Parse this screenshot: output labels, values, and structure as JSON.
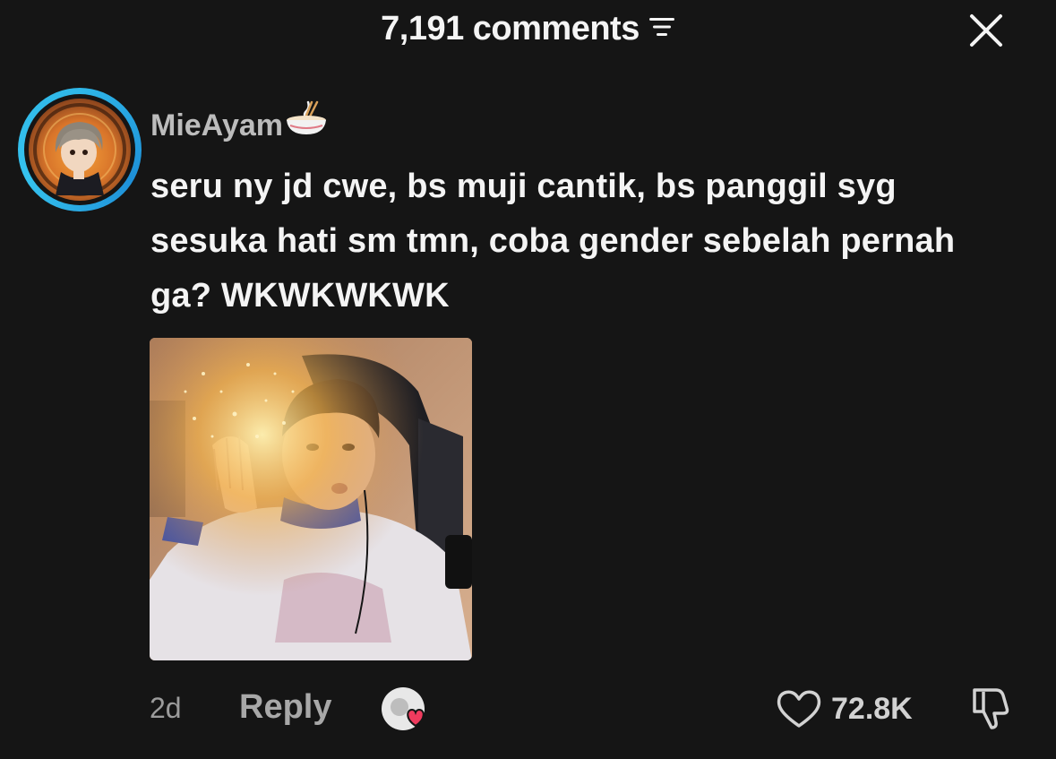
{
  "header": {
    "title": "7,191 comments",
    "sort_icon": "sort-lines-icon",
    "close_icon": "close-icon"
  },
  "comment": {
    "username": "MieAyam",
    "username_emoji": "noodle-bowl-icon",
    "text": "seru ny jd cwe, bs muji cantik, bs panggil syg sesuka hati sm tmn, coba gender sebelah pernah ga? WKWKWKWK",
    "age": "2d",
    "reply_label": "Reply",
    "like_count": "72.8K",
    "ring_color": "#2fb7e8",
    "liked_by_creator_heart_color": "#ef3b5e"
  }
}
